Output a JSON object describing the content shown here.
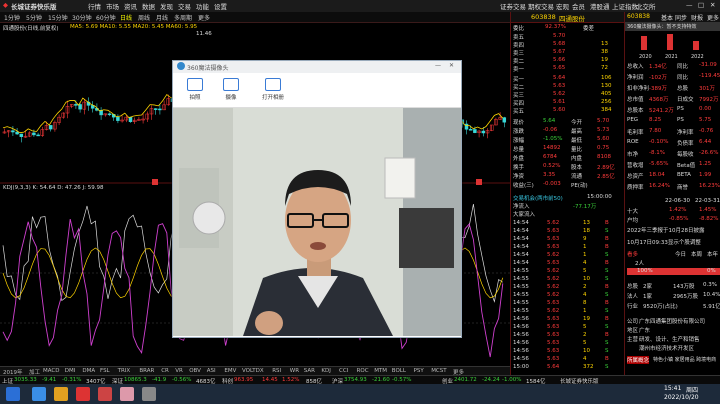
{
  "app": {
    "title": "长城证券快乐版",
    "menu": [
      "行情",
      "市场",
      "资讯",
      "数据",
      "发现",
      "交易",
      "功能",
      "设置"
    ],
    "right_links": [
      "证券交易",
      "期权交易",
      "宏观",
      "会员",
      "港股通",
      "上证指数",
      "北交所"
    ]
  },
  "toolbar": {
    "items": [
      "1分钟",
      "5分钟",
      "15分钟",
      "30分钟",
      "60分钟",
      "日线",
      "周线",
      "月线",
      "多周期",
      "更多"
    ]
  },
  "chart": {
    "stock_label": "四通股份(日线,前复权)",
    "ma_line": "MA5: 5.69  MA10: 5.55  MA20: 5.45  MA60: 5.95",
    "high_mark": "11.46",
    "kdj_line": "KDJ(9,3,3) K: 54.64  D: 47.26  J: 59.98"
  },
  "camera_window": {
    "title": "360魔法摄像头",
    "tools": [
      {
        "label": "拍照",
        "icon": "camera-icon"
      },
      {
        "label": "摄像",
        "icon": "video-icon"
      },
      {
        "label": "打开相册",
        "icon": "album-icon"
      }
    ]
  },
  "quote": {
    "code": "603838",
    "name": "四通股份",
    "ratio_label": "委比",
    "ratio_value": "92.37%",
    "diff_label": "委差",
    "asks": [
      {
        "label": "卖五",
        "price": "5.70",
        "vol": ""
      },
      {
        "label": "卖四",
        "price": "5.68",
        "vol": "13"
      },
      {
        "label": "卖三",
        "price": "5.67",
        "vol": "38"
      },
      {
        "label": "卖二",
        "price": "5.66",
        "vol": "19"
      },
      {
        "label": "卖一",
        "price": "5.65",
        "vol": "72"
      }
    ],
    "bids": [
      {
        "label": "买一",
        "price": "5.64",
        "vol": "106"
      },
      {
        "label": "买二",
        "price": "5.63",
        "vol": "130"
      },
      {
        "label": "买三",
        "price": "5.62",
        "vol": "405"
      },
      {
        "label": "买四",
        "price": "5.61",
        "vol": "256"
      },
      {
        "label": "买五",
        "price": "5.60",
        "vol": "384"
      }
    ],
    "stats": [
      [
        "现价",
        "5.64",
        "今开",
        "5.70"
      ],
      [
        "涨跌",
        "-0.06",
        "最高",
        "5.73"
      ],
      [
        "涨幅",
        "-1.05%",
        "最低",
        "5.60"
      ],
      [
        "总量",
        "14892",
        "量比",
        "0.75"
      ],
      [
        "外盘",
        "6784",
        "内盘",
        "8108"
      ],
      [
        "换手",
        "0.52%",
        "股本",
        "2.89亿"
      ],
      [
        "净资",
        "3.35",
        "流通",
        "2.85亿"
      ],
      [
        "收益(三)",
        "-0.003",
        "PE(动)",
        ""
      ]
    ],
    "trades_header": "交易机会(两市前50)",
    "trades_time": "15:00:00",
    "net_inflow": "净流入",
    "net_value": "-77.17万",
    "big_flow": "大家流入",
    "ticks": [
      [
        "14:54",
        "5.62",
        "13",
        "B"
      ],
      [
        "14:54",
        "5.63",
        "18",
        "S"
      ],
      [
        "14:54",
        "5.63",
        "9",
        "B"
      ],
      [
        "14:54",
        "5.63",
        "1",
        "B"
      ],
      [
        "14:54",
        "5.62",
        "1",
        "S"
      ],
      [
        "14:54",
        "5.63",
        "4",
        "B"
      ],
      [
        "14:55",
        "5.62",
        "5",
        "S"
      ],
      [
        "14:55",
        "5.62",
        "10",
        "S"
      ],
      [
        "14:55",
        "5.62",
        "2",
        "B"
      ],
      [
        "14:55",
        "5.62",
        "4",
        "S"
      ],
      [
        "14:55",
        "5.63",
        "8",
        "B"
      ],
      [
        "14:55",
        "5.62",
        "1",
        "S"
      ],
      [
        "14:56",
        "5.63",
        "19",
        "B"
      ],
      [
        "14:56",
        "5.63",
        "5",
        "S"
      ],
      [
        "14:56",
        "5.63",
        "2",
        "B"
      ],
      [
        "14:56",
        "5.63",
        "5",
        "S"
      ],
      [
        "14:56",
        "5.63",
        "10",
        "S"
      ],
      [
        "14:56",
        "5.63",
        "4",
        "B"
      ],
      [
        "15:00",
        "5.64",
        "372",
        "S"
      ]
    ]
  },
  "f10": {
    "code": "603838",
    "tabs": [
      "基本",
      "同步",
      "财报",
      "更多"
    ],
    "notice": "360魔法摄像头：暂不支持特效",
    "years": [
      "2020",
      "2021",
      "2022"
    ],
    "rows": [
      [
        "总收入",
        "1.34亿",
        "同比",
        "-31.09"
      ],
      [
        "净利润",
        "-102万",
        "同比",
        "-119.45"
      ],
      [
        "扣非净利",
        "-389万",
        "总股",
        "301万"
      ],
      [
        "总市值",
        "4368万",
        "日成交",
        "7992万"
      ],
      [
        "总股本",
        "5241.2万",
        "PS",
        "0.00"
      ],
      [
        "PEG",
        "8.25",
        "PS",
        "5.75"
      ],
      [
        "毛利率",
        "7.80",
        "净利率",
        "-0.76"
      ],
      [
        "ROE",
        "-0.10%",
        "负债率",
        "6.44"
      ],
      [
        "市净",
        "-8.1%",
        "每股收",
        "-26.6%"
      ],
      [
        "营收增",
        "-5.65%",
        "Beta值",
        "1.25"
      ],
      [
        "总资产",
        "18.04",
        "BETA",
        "1.99"
      ],
      [
        "质押率",
        "16.24%",
        "商誉",
        "16.23%"
      ]
    ],
    "dates": [
      "22-06-30",
      "22-03-31"
    ],
    "holders": [
      [
        "十大",
        "1.42%",
        "1.45%"
      ],
      [
        "户均",
        "-0.85%",
        "-8.82%"
      ]
    ],
    "report_notice": "2022年三季报于10月28日披露",
    "broker_notice": "10月17日09:33显示个股调整",
    "sentiment_tabs": [
      "今日",
      "本周",
      "本年"
    ],
    "bull_label": "看多",
    "bull_count": "2人",
    "bull_pct": "100%",
    "bear_pct": "0%",
    "bull_fraction": 1.0,
    "info": [
      [
        "总股",
        "2家",
        "143万股",
        "0.3%"
      ],
      [
        "法人",
        "1家",
        "2965万股",
        "10.4%"
      ],
      [
        "行业",
        "9520万(占比)",
        "",
        "5.91亿(占)"
      ]
    ],
    "company_label": "公司",
    "company": "广东四通集团股份有限公司",
    "region_label": "地区",
    "region": "广东",
    "product_label": "主营",
    "product": "研发、设计、生产和销售",
    "address": "潮州市经济技术开发区",
    "concept_label": "所属概念",
    "concept": "特色小镇 家居用品 跨境电商"
  },
  "tabs_bottom": [
    "2019年",
    "加工",
    "MACD",
    "DMI",
    "DMA",
    "FSL",
    "TRIX",
    "BRAR",
    "CR",
    "VR",
    "OBV",
    "ASI",
    "EMV",
    "VOLTDX",
    "RSI",
    "WR",
    "SAR",
    "KDJ",
    "CCI",
    "ROC",
    "MTM",
    "BOLL",
    "PSY",
    "MCST",
    "更多"
  ],
  "ticker": [
    {
      "name": "上证",
      "value": "3035.33",
      "chg": "-9.41",
      "pct": "-0.31%",
      "amt": "3407亿",
      "color": "#3ad13a"
    },
    {
      "name": "深证",
      "value": "10865.3",
      "chg": "-41.9",
      "pct": "-0.56%",
      "amt": "4683亿",
      "color": "#3ad13a"
    },
    {
      "name": "科创",
      "value": "963.95",
      "chg": "14.45",
      "pct": "1.52%",
      "amt": "858亿",
      "color": "#ff3b3b"
    },
    {
      "name": "沪深",
      "value": "3754.93",
      "chg": "-21.60",
      "pct": "-0.57%",
      "amt": "",
      "color": "#3ad13a"
    },
    {
      "name": "创业",
      "value": "2401.72",
      "chg": "-24.24",
      "pct": "-1.00%",
      "amt": "1584亿",
      "color": "#3ad13a"
    }
  ],
  "ticker_center": "长城证券快乐版",
  "clock": {
    "time": "15:41",
    "day": "周四",
    "date": "2022/10/20"
  }
}
